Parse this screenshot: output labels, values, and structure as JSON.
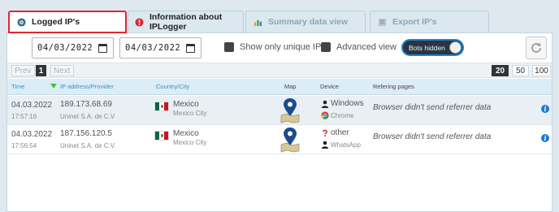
{
  "tabs": [
    {
      "label": "Logged IP's",
      "active": true
    },
    {
      "label": "Information about IPLogger",
      "active": false
    },
    {
      "label": "Summary data view",
      "active": false
    },
    {
      "label": "Export IP's",
      "active": false
    }
  ],
  "filters": {
    "date_from": "04/03/2022",
    "date_to": "04/03/2022",
    "unique_ip_label": "Show only unique IP",
    "advanced_label": "Advanced view",
    "bots_toggle_label": "Bots hidden"
  },
  "pager": {
    "prev": "Prev",
    "current": "1",
    "next": "Next",
    "sizes": [
      "20",
      "50",
      "100"
    ],
    "selected_size": "20"
  },
  "columns": {
    "time": "Time",
    "ip": "IP address/Provider",
    "country": "Country/City",
    "map": "Map",
    "device": "Device",
    "referer": "Refering pages"
  },
  "rows": [
    {
      "date": "04.03.2022",
      "time": "17:57:16",
      "ip": "189.173.68.69",
      "provider": "Uninet S.A. de C.V",
      "country": "Mexico",
      "city": "Mexico City",
      "device": "Windows",
      "browser": "Chrome",
      "referer": "Browser didn't send referrer data"
    },
    {
      "date": "04.03.2022",
      "time": "17:56:54",
      "ip": "187.156.120.5",
      "provider": "Uninet S.A. de C.V.",
      "country": "Mexico",
      "city": "Mexico City",
      "device": "other",
      "browser": "WhatsApp",
      "referer": "Browser didn't send referrer data"
    }
  ],
  "colors": {
    "active_tab_border": "#e02632",
    "accent_blue": "#3b8dc4",
    "toggle_border": "#1686d8",
    "mexico_green": "#006847",
    "mexico_red": "#ce1126"
  }
}
